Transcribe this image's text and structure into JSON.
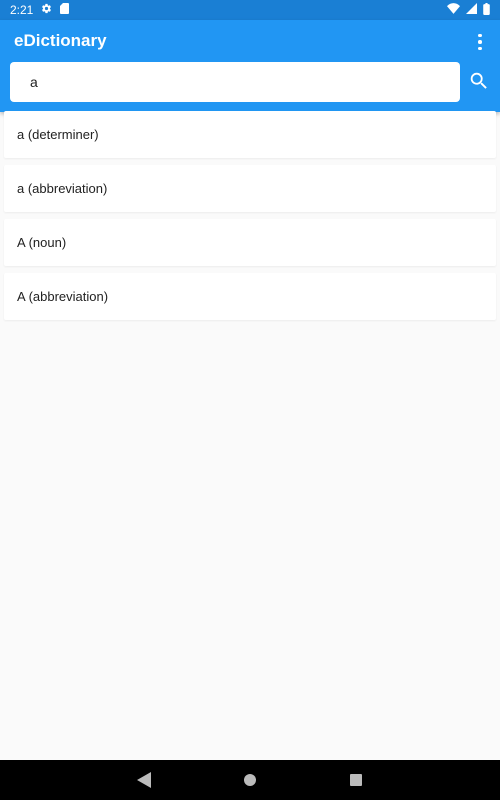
{
  "status_bar": {
    "time": "2:21",
    "icons": [
      "gear-icon",
      "sim-card-icon",
      "wifi-icon",
      "signal-icon",
      "battery-icon"
    ]
  },
  "app_bar": {
    "title": "eDictionary",
    "menu_icon": "more-vert-icon",
    "background": "#2196f3"
  },
  "search": {
    "value": "a",
    "icon": "search-icon"
  },
  "results": [
    {
      "label": "a (determiner)"
    },
    {
      "label": "a (abbreviation)"
    },
    {
      "label": "A (noun)"
    },
    {
      "label": "A (abbreviation)"
    }
  ],
  "nav_bar": {
    "icons": [
      "back-icon",
      "home-icon",
      "recents-icon"
    ]
  }
}
